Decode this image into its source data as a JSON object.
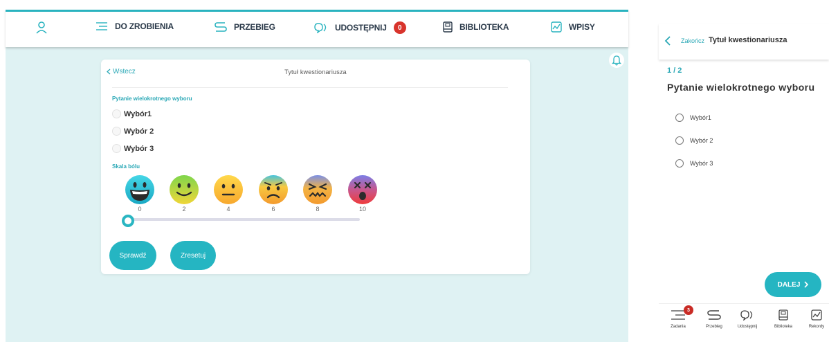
{
  "desktop": {
    "nav": [
      {
        "icon": "user-icon",
        "label": ""
      },
      {
        "icon": "list-icon",
        "label": "DO ZROBIENIA"
      },
      {
        "icon": "route-icon",
        "label": "PRZEBIEG"
      },
      {
        "icon": "share-icon",
        "label": "UDOSTĘPNIJ",
        "badge": "0"
      },
      {
        "icon": "book-icon",
        "label": "BIBLIOTEKA"
      },
      {
        "icon": "chart-icon",
        "label": "WPISY"
      }
    ],
    "card": {
      "back_label": "Wstecz",
      "title": "Tytuł kwestionariusza",
      "question_label": "Pytanie wielokrotnego wyboru",
      "choices": [
        "Wybór1",
        "Wybór 2",
        "Wybór 3"
      ],
      "pain_label": "Skala bólu",
      "scale": [
        "0",
        "2",
        "4",
        "6",
        "8",
        "10"
      ],
      "slider_value": 0,
      "check_button": "Sprawdź",
      "reset_button": "Zresetuj"
    },
    "colors": {
      "accent": "#25b5c2",
      "background": "#dff2f3",
      "badge": "#d8342c"
    }
  },
  "mobile": {
    "finish_label": "Zakończ",
    "title": "Tytuł kwestionariusza",
    "progress": "1 / 2",
    "question": "Pytanie wielokrotnego wyboru",
    "choices": [
      "Wybór1",
      "Wybór 2",
      "Wybór 3"
    ],
    "next_button": "DALEJ",
    "tabs": [
      {
        "label": "Zadania",
        "icon": "list-icon",
        "badge": "3"
      },
      {
        "label": "Przebieg",
        "icon": "route-icon"
      },
      {
        "label": "Udostępnij",
        "icon": "share-icon"
      },
      {
        "label": "Biblioteka",
        "icon": "book-icon"
      },
      {
        "label": "Rekordy",
        "icon": "chart-icon"
      }
    ]
  }
}
